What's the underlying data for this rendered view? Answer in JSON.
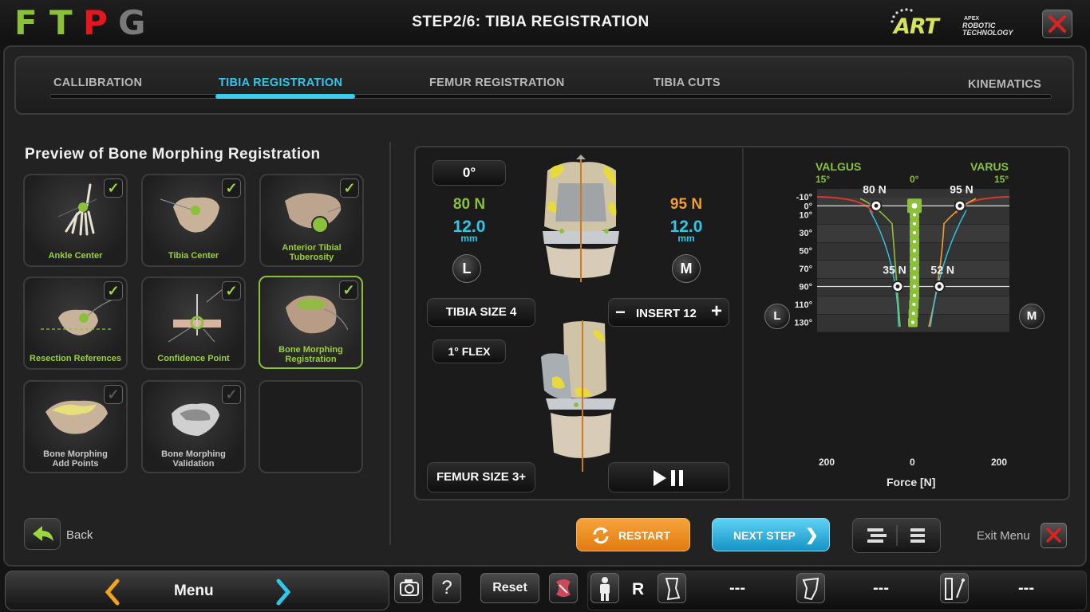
{
  "header": {
    "logo_letters": [
      "F",
      "T",
      "P",
      "G"
    ],
    "logo_colors": [
      "#8bc13a",
      "#8bc13a",
      "#e5161e",
      "#7a7a7a"
    ],
    "title": "STEP2/6: TIBIA REGISTRATION",
    "brand": {
      "word": "ART",
      "apex": "APEX",
      "line1": "ROBOTIC",
      "line2": "TECHNOLOGY"
    },
    "close_icon": "close-x-icon"
  },
  "tabs": [
    {
      "label": "CALLIBRATION",
      "active": false
    },
    {
      "label": "TIBIA REGISTRATION",
      "active": true
    },
    {
      "label": "FEMUR REGISTRATION",
      "active": false
    },
    {
      "label": "TIBIA CUTS",
      "active": false
    },
    {
      "label": "KINEMATICS",
      "active": false
    }
  ],
  "left_panel": {
    "title": "Preview of Bone Morphing Registration",
    "tiles": [
      {
        "label": "Ankle Center",
        "checked": true,
        "icon": "ankle-bone-icon"
      },
      {
        "label": "Tibia Center",
        "checked": true,
        "icon": "tibia-plateau-icon"
      },
      {
        "label": "Anterior Tibial\nTuberosity",
        "checked": true,
        "icon": "tibia-tuberosity-icon"
      },
      {
        "label": "Resection References",
        "checked": true,
        "icon": "resection-icon"
      },
      {
        "label": "Confidence Point",
        "checked": true,
        "icon": "confidence-point-icon"
      },
      {
        "label": "Bone Morphing\nRegistration",
        "checked": true,
        "icon": "bone-morphing-icon",
        "selected": true
      },
      {
        "label": "Bone Morphing\nAdd Points",
        "checked": false,
        "icon": "add-points-icon"
      },
      {
        "label": "Bone Morphing\nValidation",
        "checked": false,
        "icon": "validation-icon"
      },
      {
        "label": "",
        "checked": false,
        "empty": true
      }
    ],
    "back_label": "Back"
  },
  "knee_view": {
    "angle": "0°",
    "left_force": "80 N",
    "left_gap": "12.0",
    "left_gap_unit": "mm",
    "right_force": "95 N",
    "right_gap": "12.0",
    "right_gap_unit": "mm",
    "left_side": "L",
    "right_side": "M",
    "tibia_size": "TIBIA SIZE 4",
    "insert_label": "INSERT 12",
    "flex": "1° FLEX",
    "femur_size": "FEMUR SIZE 3+",
    "colors": {
      "left": "#8bc13a",
      "right": "#f0a030",
      "gap": "#2fc7ea"
    }
  },
  "chart_data": {
    "type": "line",
    "title": "",
    "xlabel": "Force [N]",
    "x_ticks": [
      "200",
      "0",
      "200"
    ],
    "y_ticks": [
      "-10°",
      "0°",
      "10°",
      "30°",
      "50°",
      "70°",
      "90°",
      "110°",
      "130°"
    ],
    "top_labels": {
      "valgus": "VALGUS",
      "varus": "VARUS",
      "valgus_deg": "15°",
      "center_deg": "0°",
      "varus_deg": "15°"
    },
    "side_left": "L",
    "side_right": "M",
    "readings": [
      {
        "flexion_deg": 0,
        "left_force_N": 80,
        "right_force_N": 95,
        "left_label": "80 N",
        "right_label": "95 N"
      },
      {
        "flexion_deg": 90,
        "left_force_N": 35,
        "right_force_N": 52,
        "left_label": "35 N",
        "right_label": "52 N"
      }
    ]
  },
  "actions": {
    "restart": "RESTART",
    "next": "NEXT STEP",
    "exit": "Exit Menu"
  },
  "footer": {
    "menu_label": "Menu",
    "reset_label": "Reset",
    "side": "R",
    "status_values": [
      "---",
      "---",
      "---"
    ]
  }
}
